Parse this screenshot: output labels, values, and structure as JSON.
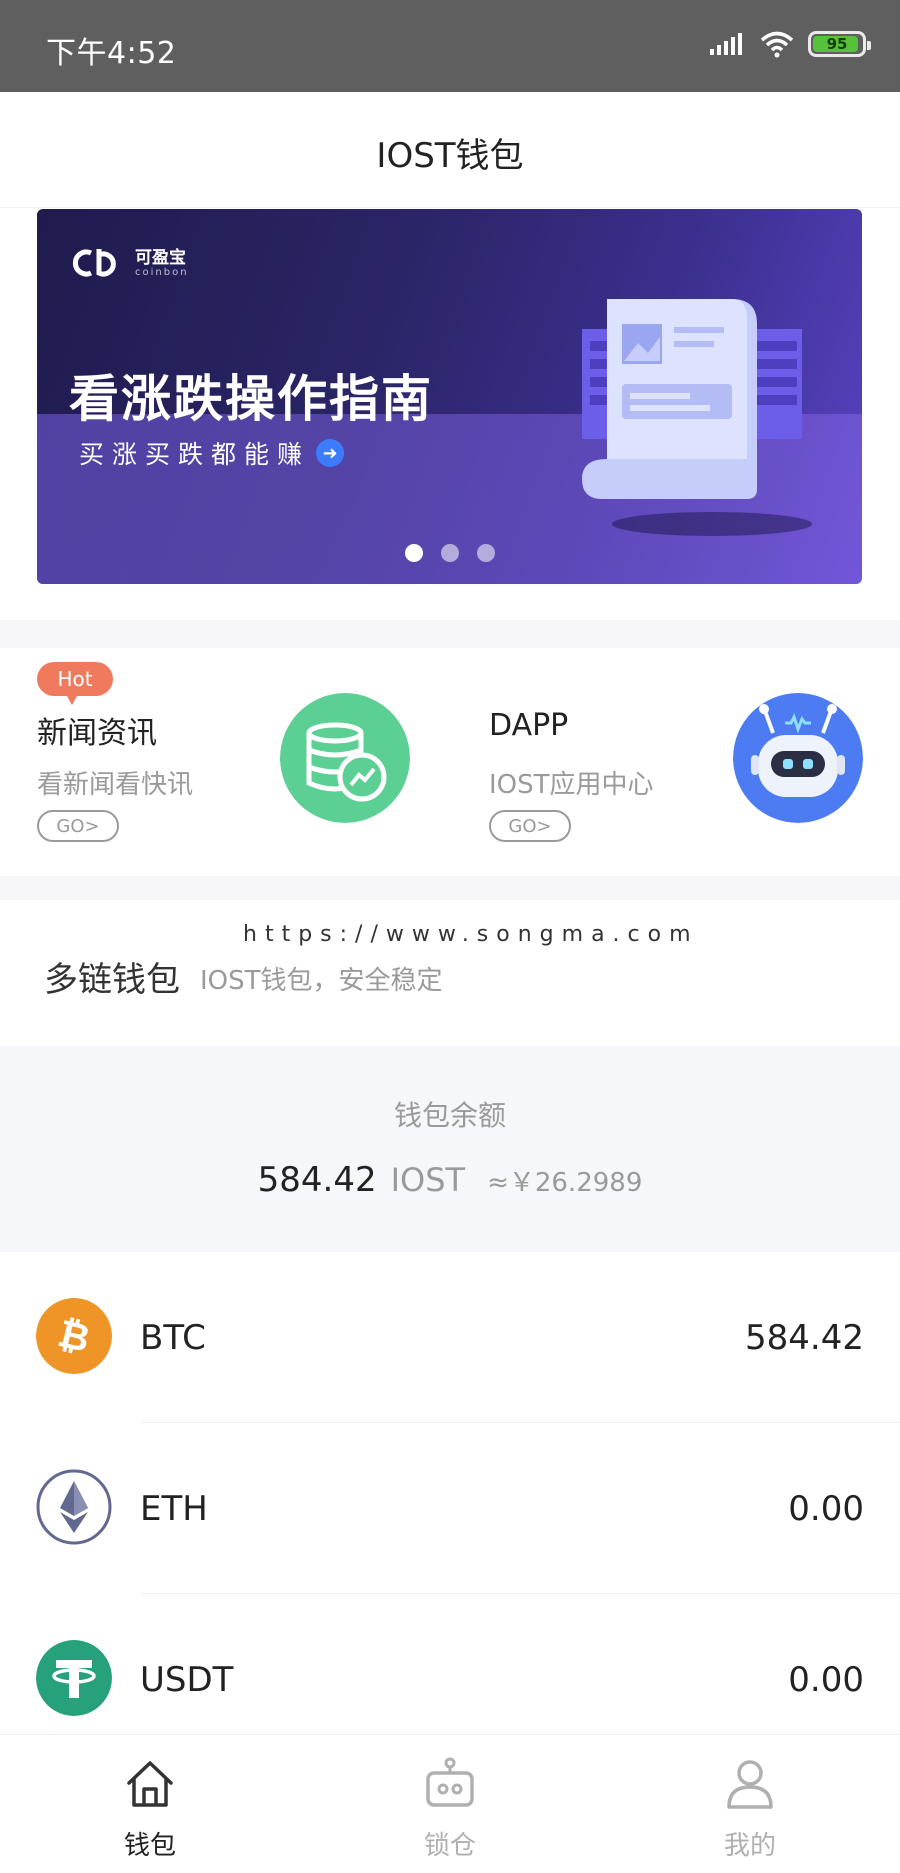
{
  "status_bar": {
    "time": "下午4:52",
    "battery_level": "95",
    "battery_color": "#56c23a"
  },
  "nav": {
    "title": "IOST钱包"
  },
  "banner": {
    "logo_text": "可盈宝",
    "logo_sub": "coinbon",
    "title": "看涨跌操作指南",
    "subtitle": "买涨买跌都能赚",
    "slide_count": 3,
    "active_slide": 0
  },
  "features": [
    {
      "badge": "Hot",
      "title": "新闻资讯",
      "subtitle": "看新闻看快讯",
      "button": "GO>",
      "icon": "coins-chart-icon",
      "icon_color": "#5ccf94"
    },
    {
      "badge": "",
      "title": "DAPP",
      "subtitle": "IOST应用中心",
      "button": "GO>",
      "icon": "robot-icon",
      "icon_color": "#4d7cf2"
    }
  ],
  "watermark": "https://www.songma.com",
  "multichain": {
    "title": "多链钱包",
    "subtitle": "IOST钱包，安全稳定"
  },
  "balance": {
    "label": "钱包余额",
    "amount": "584.42",
    "unit": "IOST",
    "cny": "≈￥26.2989"
  },
  "coins": [
    {
      "name": "BTC",
      "amount": "584.42",
      "icon": "bitcoin-icon",
      "color": "#ef9426"
    },
    {
      "name": "ETH",
      "amount": "0.00",
      "icon": "ethereum-icon",
      "color": "#62688f"
    },
    {
      "name": "USDT",
      "amount": "0.00",
      "icon": "tether-icon",
      "color": "#26a17b"
    }
  ],
  "tabs": [
    {
      "label": "钱包",
      "icon": "home-icon",
      "active": true
    },
    {
      "label": "锁仓",
      "icon": "robot-lock-icon",
      "active": false
    },
    {
      "label": "我的",
      "icon": "user-icon",
      "active": false
    }
  ]
}
